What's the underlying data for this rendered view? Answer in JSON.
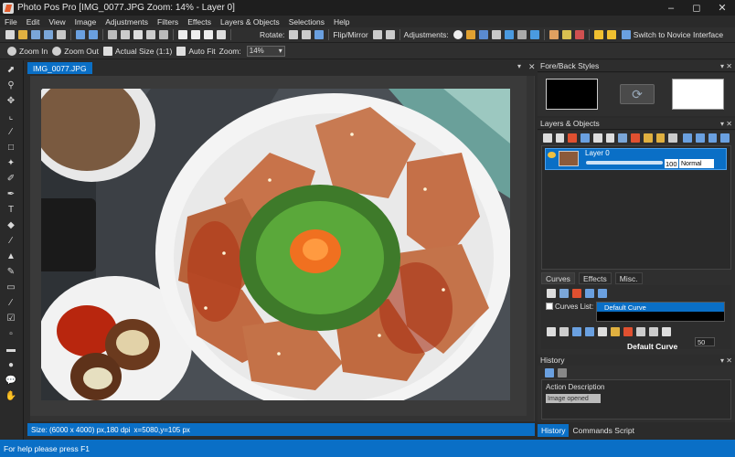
{
  "window": {
    "title": "Photo Pos Pro [IMG_0077.JPG Zoom: 14% - Layer 0]",
    "controls": [
      "minimize",
      "maximize",
      "close"
    ]
  },
  "menu": [
    "File",
    "Edit",
    "View",
    "Image",
    "Adjustments",
    "Filters",
    "Effects",
    "Layers & Objects",
    "Selections",
    "Help"
  ],
  "toolbar1": {
    "rotate_label": "Rotate:",
    "flip_label": "Flip/Mirror",
    "adjustments_label": "Adjustments:",
    "novice_label": "Switch to Novice Interface"
  },
  "toolbar2": {
    "zoom_in": "Zoom In",
    "zoom_out": "Zoom Out",
    "actual_size": "Actual Size (1:1)",
    "auto_fit": "Auto Fit",
    "zoom_label": "Zoom:",
    "zoom_value": "14%"
  },
  "document": {
    "tab_label": "IMG_0077.JPG",
    "status_size": "Size: (6000 x 4000) px,180 dpi",
    "status_coords": "x=5080,y=105 px"
  },
  "panels": {
    "fore_back": {
      "title": "Fore/Back Styles",
      "fore_color": "#000000",
      "back_color": "#ffffff"
    },
    "layers": {
      "title": "Layers & Objects",
      "layer_name": "Layer 0",
      "opacity": "100",
      "blend_mode": "Normal",
      "sub_tabs": [
        "Curves",
        "Effects",
        "Misc."
      ],
      "curves_list_label": "Curves List:",
      "curves_list_item": "Default Curve",
      "curve_name": "Default Curve",
      "curve_value": "50"
    },
    "history": {
      "title": "History",
      "column": "Action Description",
      "entry": "Image opened"
    },
    "bottom_tabs": [
      "History",
      "Commands Script"
    ]
  },
  "status_bar": "For help please press F1",
  "colors": {
    "accent": "#0a6fc6",
    "background": "#2b2b2b"
  }
}
